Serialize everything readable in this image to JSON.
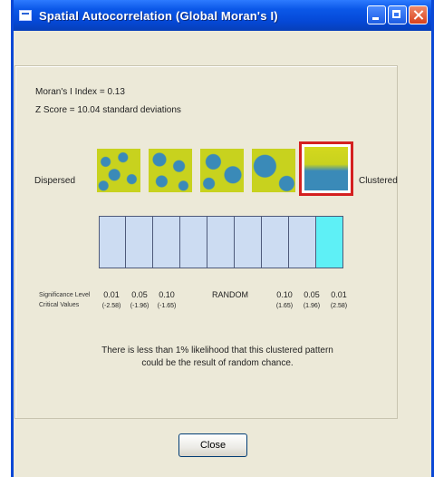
{
  "window": {
    "title": "Spatial Autocorrelation (Global Moran's I)"
  },
  "stats": {
    "morans_i": "Moran's I Index = 0.13",
    "z_score": "Z Score = 10.04 standard deviations"
  },
  "pattern": {
    "left_label": "Dispersed",
    "right_label": "Clustered",
    "selected": "Clustered"
  },
  "significance": {
    "label_sig": "Significance Level",
    "label_crit": "Critical Values",
    "values": [
      "0.01",
      "0.05",
      "0.10",
      "RANDOM",
      "0.10",
      "0.05",
      "0.01"
    ],
    "critical": [
      "(-2.58)",
      "(-1.96)",
      "(-1.65)",
      "",
      "(1.65)",
      "(1.96)",
      "(2.58)"
    ],
    "active_segment": 9
  },
  "message": {
    "line1": "There is less than 1% likelihood that this clustered pattern",
    "line2": "could be the result of random chance."
  },
  "buttons": {
    "close": "Close"
  },
  "colors": {
    "active_segment": "#5ef0f6",
    "segment": "#ccdcf2",
    "highlight_border": "#d42020"
  }
}
